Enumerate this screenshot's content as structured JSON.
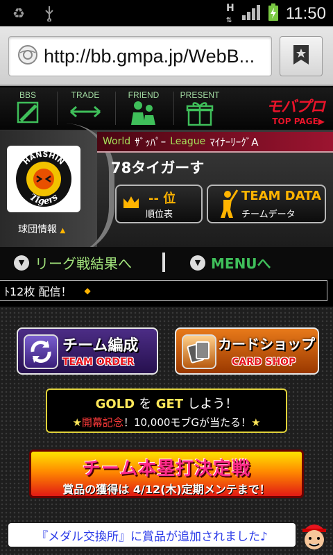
{
  "status_bar": {
    "time": "11:50",
    "icons": [
      "recycle-icon",
      "usb-icon",
      "h-signal-icon",
      "signal-bars-icon",
      "battery-charging-icon"
    ]
  },
  "browser": {
    "url": "http://bb.gmpa.jp/WebB...",
    "icons": [
      "globe-icon",
      "bookmark-star-icon"
    ]
  },
  "nav": {
    "items": [
      {
        "label": "BBS",
        "icon": "bbs-icon"
      },
      {
        "label": "TRADE",
        "icon": "trade-arrows-icon"
      },
      {
        "label": "FRIEND",
        "icon": "friend-icon"
      },
      {
        "label": "PRESENT",
        "icon": "present-icon"
      }
    ],
    "brand": "モバプロ",
    "brand_sub": "TOP PAGE▶"
  },
  "team": {
    "logo_top": "HANSHIN",
    "logo_bottom": "Tigers",
    "info_label": "球団情報",
    "info_arrow": "▲",
    "league": {
      "world_label": "World",
      "world_name": "ｻﾞｯﾊﾟｰ",
      "league_label": "League",
      "league_name": "ﾏｲﾅｰﾘｰｸﾞA"
    },
    "name": "78タイガーす",
    "rank": {
      "value": "-- 位",
      "label": "順位表",
      "icon": "crown-icon"
    },
    "team_data": {
      "title": "TEAM DATA",
      "label": "チームデータ",
      "icon": "batter-icon"
    }
  },
  "menu": {
    "league_results": "リーグ戦結果へ",
    "menu": "MENUへ",
    "separator": "|"
  },
  "ticker": {
    "text": "ﾄ12枚 配信！",
    "marker": "◆"
  },
  "buttons": {
    "team_order": {
      "jp": "チーム編成",
      "en": "TEAM ORDER"
    },
    "card_shop": {
      "jp": "カードショップ",
      "en": "CARD SHOP"
    }
  },
  "gold_promo": {
    "line1_a": "GOLD",
    "line1_b": "を",
    "line1_c": "GET",
    "line1_d": "しよう！",
    "line2_star": "★",
    "line2_red": "開幕記念",
    "line2_rest": "！10,000モブGが当たる！",
    "line2_star_end": "★"
  },
  "homerun": {
    "title": "チーム本塁打決定戦",
    "subtitle": "賞品の獲得は 4/12(木)定期メンテまで！"
  },
  "notice": {
    "text": "『メダル交換所』に賞品が追加されました♪"
  }
}
